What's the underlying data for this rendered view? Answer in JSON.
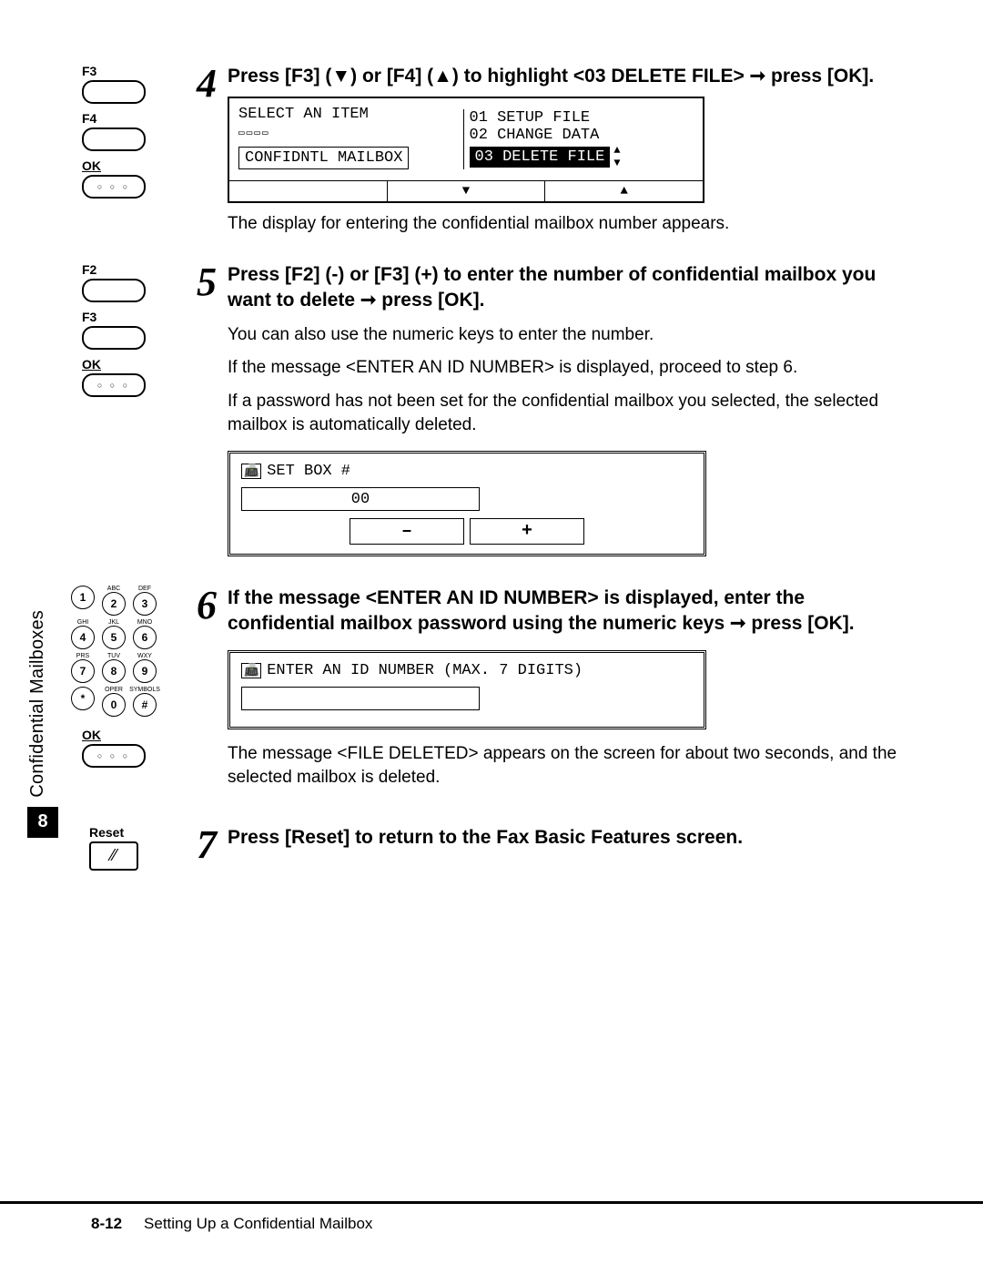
{
  "sideTab": {
    "label": "Confidential Mailboxes",
    "chapter": "8"
  },
  "footer": {
    "page": "8-12",
    "title": "Setting Up a Confidential Mailbox"
  },
  "keys": {
    "f2": "F2",
    "f3": "F3",
    "f4": "F4",
    "ok": "OK",
    "reset": "Reset",
    "okDots": "○ ○ ○"
  },
  "step4": {
    "num": "4",
    "title": "Press [F3] (▼) or [F4] (▲) to highlight <03 DELETE FILE> ➞ press [OK].",
    "lcd": {
      "heading": "SELECT AN ITEM",
      "sub": "CONFIDNTL MAILBOX",
      "items": [
        "01 SETUP FILE",
        "02 CHANGE DATA",
        "03 DELETE FILE"
      ],
      "navLeft": "▼",
      "navRight": "▲"
    },
    "after": "The display for entering the confidential mailbox number appears."
  },
  "step5": {
    "num": "5",
    "title": "Press [F2] (-) or [F3] (+) to enter the number of confidential mailbox you want to delete ➞ press [OK].",
    "p1": "You can also use the numeric keys to enter the number.",
    "p2": "If the message <ENTER AN ID NUMBER> is displayed, proceed to step 6.",
    "p3": "If a password has not been set for the confidential mailbox you selected, the selected mailbox is automatically deleted.",
    "lcd": {
      "heading": "SET BOX #",
      "value": "00",
      "minus": "–",
      "plus": "+"
    }
  },
  "step6": {
    "num": "6",
    "title": "If the message <ENTER AN ID NUMBER> is displayed, enter the confidential mailbox password using the numeric keys ➞ press [OK].",
    "lcd": {
      "heading": "ENTER AN ID NUMBER (MAX. 7 DIGITS)"
    },
    "after": "The message <FILE DELETED> appears on the screen for about two seconds, and the selected mailbox is deleted."
  },
  "step7": {
    "num": "7",
    "title": "Press [Reset] to return to the Fax Basic Features screen."
  },
  "keypad": {
    "labels": [
      "",
      "ABC",
      "DEF",
      "GHI",
      "JKL",
      "MNO",
      "PRS",
      "TUV",
      "WXY",
      "",
      "OPER",
      "SYMBOLS"
    ],
    "keys": [
      "1",
      "2",
      "3",
      "4",
      "5",
      "6",
      "7",
      "8",
      "9",
      "*",
      "0",
      "#"
    ]
  }
}
